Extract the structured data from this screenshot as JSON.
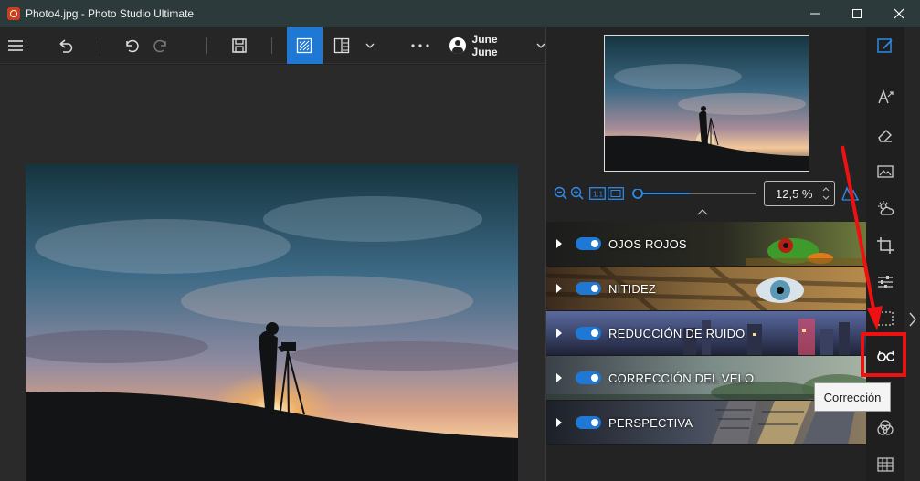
{
  "window": {
    "title": "Photo4.jpg - Photo Studio Ultimate",
    "controls": [
      "minimize-icon",
      "maximize-icon",
      "close-icon"
    ]
  },
  "toolbar": {
    "items": [
      "menu-icon",
      "undo-all-icon",
      "undo-icon",
      "redo-icon",
      "save-icon",
      "single-view-icon",
      "compare-view-icon",
      "chevron-down-icon",
      "more-icon"
    ],
    "user_name": "June June"
  },
  "zoom": {
    "value": "12,5 %",
    "level": 0.125
  },
  "corrections": [
    {
      "label": "OJOS ROJOS",
      "enabled": true
    },
    {
      "label": "NITIDEZ",
      "enabled": true
    },
    {
      "label": "REDUCCIÓN DE RUIDO",
      "enabled": true
    },
    {
      "label": "CORRECCIÓN DEL VELO",
      "enabled": true
    },
    {
      "label": "PERSPECTIVA",
      "enabled": true
    }
  ],
  "sidebar": {
    "icons": [
      "edit-icon",
      "text-icon",
      "eraser-icon",
      "image-icon",
      "weather-icon",
      "crop-icon",
      "adjust-icon",
      "selection-icon",
      "glasses-icon",
      "color-icon",
      "texture-icon"
    ],
    "tooltip": "Corrección"
  },
  "colors": {
    "accent": "#1e78d4",
    "highlight": "#ee1111",
    "titlebar": "#2c3a3c"
  }
}
